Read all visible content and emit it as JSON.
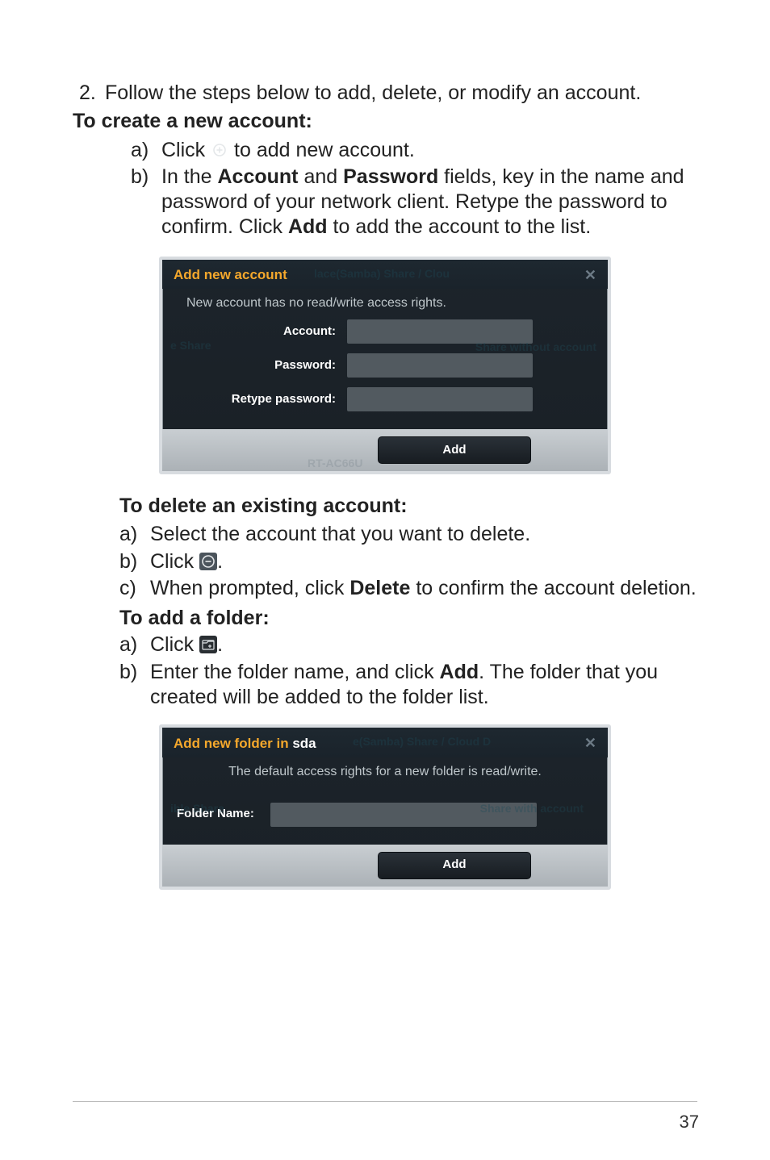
{
  "step2": {
    "num": "2.",
    "text": "Follow the steps below to add, delete, or modify an account."
  },
  "create": {
    "heading": "To create a new account:",
    "a": {
      "lbl": "a)",
      "pre": "Click ",
      "post": " to add new account."
    },
    "b": {
      "lbl": "b)",
      "t1": "In the ",
      "bold1": "Account",
      "t2": " and ",
      "bold2": "Password",
      "t3": " fields, key in the name and password of your network client. Retype the password to confirm. Click ",
      "bold3": "Add",
      "t4": " to add the account to the list."
    }
  },
  "dialog1": {
    "title": "Add new account",
    "desc": "New account has no read/write access rights.",
    "account_label": "Account:",
    "password_label": "Password:",
    "retype_label": "Retype password:",
    "add_btn": "Add",
    "ghost_title_tail": "lace(Samba) Share / Clou",
    "ghost_share": "e Share",
    "ghost_swa": "Share without account",
    "ghost_model": "RT-AC66U"
  },
  "delete": {
    "heading": "To delete an existing account:",
    "a": {
      "lbl": "a)",
      "text": "Select the account that you want to delete."
    },
    "b": {
      "lbl": "b)",
      "pre": "Click ",
      "post": "."
    },
    "c": {
      "lbl": "c)",
      "t1": "When prompted, click ",
      "bold": "Delete",
      "t2": " to confirm the account deletion."
    }
  },
  "addfolder": {
    "heading": "To add a folder:",
    "a": {
      "lbl": "a)",
      "pre": "Click ",
      "post": "."
    },
    "b": {
      "lbl": "b)",
      "t1": "Enter the folder name, and click ",
      "bold": "Add",
      "t2": ". The folder that you created will be added to the folder list."
    }
  },
  "dialog2": {
    "title_pre": "Add new folder in ",
    "title_dev": "sda",
    "desc": "The default access rights for a new folder is read/write.",
    "folder_label": "Folder Name:",
    "add_btn": "Add",
    "ghost_title_tail": "e(Samba) Share / Cloud D",
    "ghost_share": "ible Share",
    "ghost_swa": "Share with account"
  },
  "page_number": "37"
}
